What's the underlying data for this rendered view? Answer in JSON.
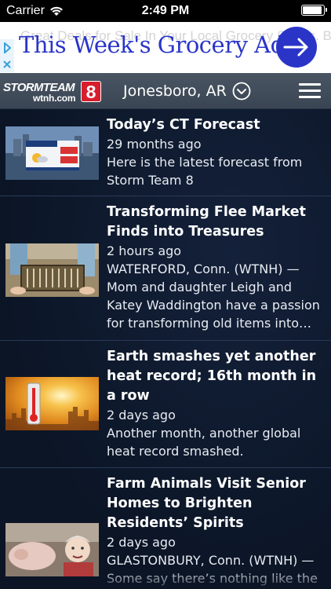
{
  "status_bar": {
    "carrier": "Carrier",
    "time": "2:49 PM"
  },
  "ad": {
    "headline": "This Week's Grocery Ad",
    "ghost_text": "Great Deals for Sale In Your Local Grocery Stores. Browse Ads on Flipp",
    "accent_color": "#2a35c8"
  },
  "header": {
    "logo_top": "STORMTEAM",
    "logo_bottom": "wtnh.com",
    "logo_number": "8",
    "location": "Jonesboro, AR"
  },
  "feed": {
    "items": [
      {
        "title": "Today’s CT Forecast",
        "time": "29 months ago",
        "summary": "Here is the latest forecast from Storm Team 8",
        "thumb": "forecast-graphic"
      },
      {
        "title": "Transforming Flee Market Finds into Treasures",
        "time": "2 hours ago",
        "summary": "WATERFORD, Conn. (WTNH) — Mom and daughter Leigh and Katey Waddington have a passion for transforming old items into…",
        "thumb": "furniture-photo"
      },
      {
        "title": "Earth smashes yet another heat record; 16th month in a row",
        "time": "2 days ago",
        "summary": "Another month, another global heat record smashed.",
        "thumb": "thermometer-sun"
      },
      {
        "title": "Farm Animals Visit Senior Homes to Brighten Residents’ Spirits",
        "time": "2 days ago",
        "summary": "GLASTONBURY, Conn. (WTNH) — Some say there’s nothing like the",
        "thumb": "pig-photo"
      }
    ]
  }
}
